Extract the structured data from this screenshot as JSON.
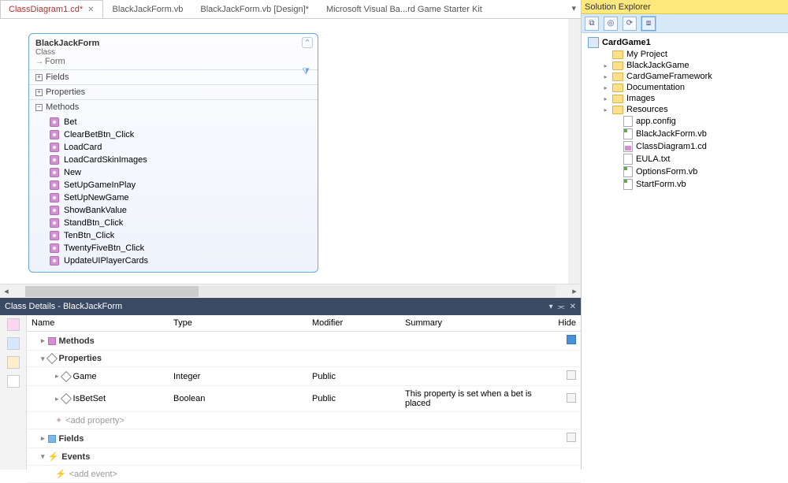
{
  "tabs": [
    {
      "label": "ClassDiagram1.cd*",
      "active": true,
      "closable": true
    },
    {
      "label": "BlackJackForm.vb",
      "active": false
    },
    {
      "label": "BlackJackForm.vb [Design]*",
      "active": false
    },
    {
      "label": "Microsoft Visual Ba...rd Game Starter Kit",
      "active": false
    }
  ],
  "classBox": {
    "title": "BlackJackForm",
    "kind": "Class",
    "inherits": "Form",
    "sections": {
      "fields": "Fields",
      "properties": "Properties",
      "methods": "Methods"
    },
    "methods": [
      "Bet",
      "ClearBetBtn_Click",
      "LoadCard",
      "LoadCardSkinImages",
      "New",
      "SetUpGameInPlay",
      "SetUpNewGame",
      "ShowBankValue",
      "StandBtn_Click",
      "TenBtn_Click",
      "TwentyFiveBtn_Click",
      "UpdateUIPlayerCards"
    ]
  },
  "detailsPanel": {
    "title": "Class Details - BlackJackForm",
    "columns": {
      "name": "Name",
      "type": "Type",
      "modifier": "Modifier",
      "summary": "Summary",
      "hide": "Hide"
    },
    "categories": {
      "methods": "Methods",
      "properties": "Properties",
      "fields": "Fields",
      "events": "Events"
    },
    "properties": [
      {
        "name": "Game",
        "type": "Integer",
        "modifier": "Public",
        "summary": ""
      },
      {
        "name": "IsBetSet",
        "type": "Boolean",
        "modifier": "Public",
        "summary": "This property is set when a bet is placed"
      }
    ],
    "addProperty": "<add property>",
    "addEvent": "<add event>"
  },
  "solutionExplorer": {
    "title": "Solution Explorer",
    "project": "CardGame1",
    "items": [
      {
        "label": "My Project",
        "icon": "folder",
        "depth": 2
      },
      {
        "label": "BlackJackGame",
        "icon": "folder",
        "depth": 2,
        "expandable": true
      },
      {
        "label": "CardGameFramework",
        "icon": "folder",
        "depth": 2,
        "expandable": true
      },
      {
        "label": "Documentation",
        "icon": "folder",
        "depth": 2,
        "expandable": true
      },
      {
        "label": "Images",
        "icon": "folder",
        "depth": 2,
        "expandable": true
      },
      {
        "label": "Resources",
        "icon": "folder",
        "depth": 2,
        "expandable": true
      },
      {
        "label": "app.config",
        "icon": "txtfile",
        "depth": 3
      },
      {
        "label": "BlackJackForm.vb",
        "icon": "vbfile",
        "depth": 3
      },
      {
        "label": "ClassDiagram1.cd",
        "icon": "cdfile",
        "depth": 3
      },
      {
        "label": "EULA.txt",
        "icon": "txtfile",
        "depth": 3
      },
      {
        "label": "OptionsForm.vb",
        "icon": "vbfile",
        "depth": 3
      },
      {
        "label": "StartForm.vb",
        "icon": "vbfile",
        "depth": 3
      }
    ]
  }
}
